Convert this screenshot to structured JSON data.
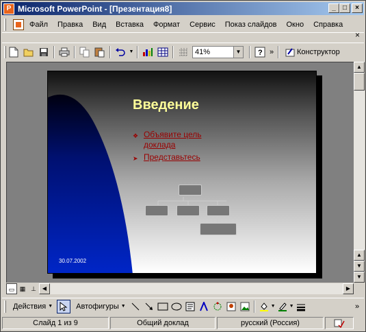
{
  "window": {
    "title": "Microsoft PowerPoint - [Презентация8]",
    "app_icon": "P"
  },
  "menu": {
    "items": [
      "Файл",
      "Правка",
      "Вид",
      "Вставка",
      "Формат",
      "Сервис",
      "Показ слайдов",
      "Окно",
      "Справка"
    ],
    "close_glyph": "×"
  },
  "toolbar": {
    "zoom_value": "41%",
    "designer_label": "Конструктор",
    "overflow_glyph": "»"
  },
  "slide": {
    "title": "Введение",
    "bullets": [
      "Объявите цель доклада",
      "Представьтесь"
    ],
    "date": "30.07.2002",
    "colors": {
      "title": "#ffff99",
      "bullet": "#990000",
      "curve": "#0026c8"
    }
  },
  "drawing_toolbar": {
    "actions_label": "Действия",
    "autoshapes_label": "Автофигуры"
  },
  "status": {
    "slide_info": "Слайд 1 из 9",
    "design": "Общий доклад",
    "language": "русский (Россия)"
  }
}
